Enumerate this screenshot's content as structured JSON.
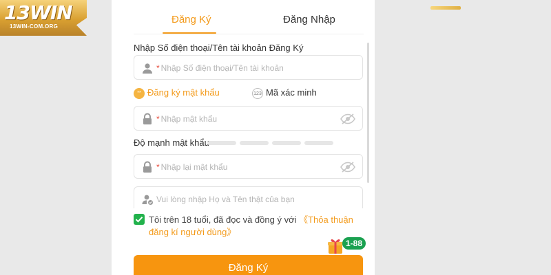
{
  "brand": {
    "logo_text": "13WIN",
    "logo_domain": "13WIN-COM.ORG"
  },
  "tabs": [
    {
      "label": "Đăng Ký",
      "active": true
    },
    {
      "label": "Đăng Nhập",
      "active": false
    }
  ],
  "form": {
    "account_label": "Nhập Số điện thoại/Tên tài khoản Đăng Ký",
    "account_placeholder": "Nhập Số điện thoại/Tên tài khoản",
    "required_mark": "*",
    "option_password": "Đăng ký mật khẩu",
    "option_code": "Mã xác minh",
    "option_code_icon": "123",
    "option_password_icon": "**",
    "password_placeholder": "Nhập mật khẩu",
    "strength_label": "Độ mạnh mật khẩu",
    "confirm_placeholder": "Nhập lại mật khẩu",
    "realname_placeholder": "Vui lòng nhập Họ và Tên thật của bạn",
    "agree_text": "Tôi trên 18 tuổi, đã đọc và đồng ý với ",
    "agree_link": "《Thỏa thuận đăng kí người dùng》",
    "agree_checked": true,
    "submit_label": "Đăng Ký"
  },
  "promo": {
    "badge": "1-88"
  },
  "colors": {
    "accent": "#f39a1a",
    "submit": "#f7950f",
    "check": "#22b24c",
    "badge": "#1aa150"
  }
}
